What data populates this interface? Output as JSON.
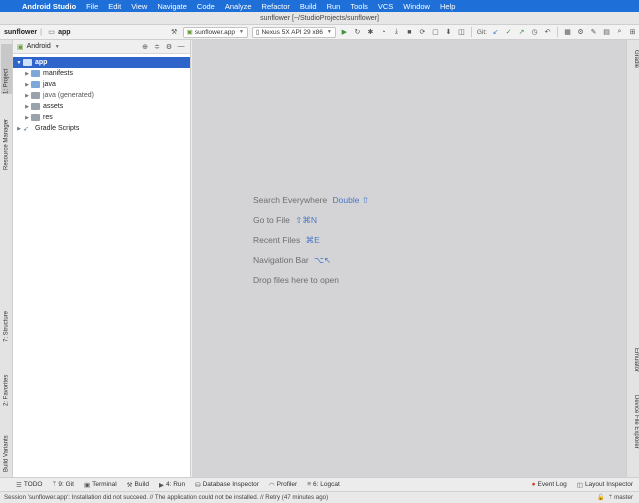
{
  "menubar": {
    "app_name": "Android Studio",
    "items": [
      "File",
      "Edit",
      "View",
      "Navigate",
      "Code",
      "Analyze",
      "Refactor",
      "Build",
      "Run",
      "Tools",
      "VCS",
      "Window",
      "Help"
    ]
  },
  "window": {
    "title": "sunflower [~/StudioProjects/sunflower]"
  },
  "navbar": {
    "project": "sunflower",
    "module": "app",
    "run_config": "sunflower.app",
    "device": "Nexus 5X API 29 x86",
    "git_label": "Git:"
  },
  "project_panel": {
    "view_mode": "Android",
    "tree": [
      {
        "label": "app",
        "level": 0,
        "expanded": true,
        "selected": true
      },
      {
        "label": "manifests",
        "level": 1
      },
      {
        "label": "java",
        "level": 1
      },
      {
        "label": "java (generated)",
        "level": 1
      },
      {
        "label": "assets",
        "level": 1
      },
      {
        "label": "res",
        "level": 1
      },
      {
        "label": "Gradle Scripts",
        "level": 0
      }
    ]
  },
  "left_tabs": {
    "project": "1: Project",
    "resource_manager": "Resource Manager",
    "structure": "7: Structure",
    "favorites": "2: Favorites",
    "build_variants": "Build Variants"
  },
  "right_tabs": {
    "gradle": "Gradle",
    "emulator": "Emulator",
    "device_explorer": "Device File Explorer"
  },
  "editor_hints": {
    "search": "Search Everywhere",
    "search_key": "Double ⇧",
    "goto": "Go to File",
    "goto_key": "⇧⌘N",
    "recent": "Recent Files",
    "recent_key": "⌘E",
    "nav": "Navigation Bar",
    "nav_key": "⌥↖",
    "drop": "Drop files here to open"
  },
  "bottom_tabs": {
    "todo": "TODO",
    "git": "9: Git",
    "terminal": "Terminal",
    "build": "Build",
    "run": "4: Run",
    "database": "Database Inspector",
    "profiler": "Profiler",
    "logcat": "6: Logcat",
    "event_log": "Event Log",
    "layout_inspector": "Layout Inspector"
  },
  "status": {
    "message": "Session 'sunflower.app': Installation did not succeed. // The application could not be installed. // Retry (47 minutes ago)",
    "branch": "master"
  }
}
